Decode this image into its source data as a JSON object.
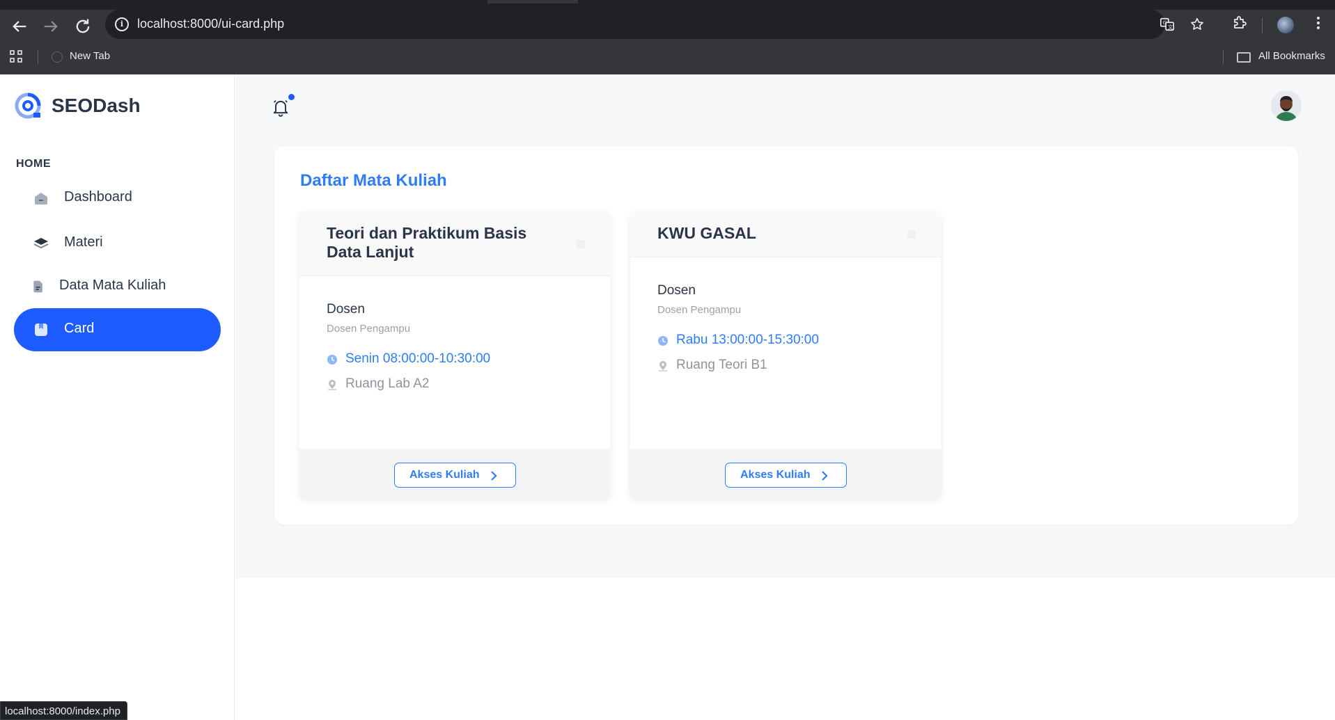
{
  "browser": {
    "url": "localhost:8000/ui-card.php",
    "bookmarks": [
      "New Tab"
    ],
    "all_bookmarks_label": "All Bookmarks",
    "status_url": "localhost:8000/index.php",
    "icons": [
      "back-icon",
      "forward-icon",
      "reload-icon",
      "site-info-icon",
      "translate-icon",
      "star-icon",
      "extensions-icon",
      "profile-avatar",
      "menu-icon",
      "apps-icon",
      "folder-icon"
    ]
  },
  "sidebar": {
    "brand": "SEODash",
    "section_caption": "HOME",
    "items": [
      {
        "label": "Dashboard",
        "icon": "dashboard-icon",
        "active": false
      },
      {
        "label": "Materi",
        "icon": "layers-icon",
        "active": false
      },
      {
        "label": "Data Mata Kuliah",
        "icon": "file-icon",
        "active": false
      },
      {
        "label": "Card",
        "icon": "bookmark-card-icon",
        "active": true
      }
    ]
  },
  "header": {
    "icons": [
      "bell-icon",
      "user-avatar"
    ]
  },
  "main": {
    "title": "Daftar Mata Kuliah",
    "courses": [
      {
        "title": "Teori dan Praktikum Basis Data Lanjut",
        "dosen_label": "Dosen",
        "dosen_value": "Dosen Pengampu",
        "schedule": "Senin 08:00:00-10:30:00",
        "room": "Ruang Lab A2",
        "button": "Akses Kuliah"
      },
      {
        "title": "KWU GASAL",
        "dosen_label": "Dosen",
        "dosen_value": "Dosen Pengampu",
        "schedule": "Rabu 13:00:00-15:30:00",
        "room": "Ruang Teori B1",
        "button": "Akses Kuliah"
      }
    ]
  },
  "colors": {
    "primary": "#1f5cff",
    "accent_text": "#2e7cf6",
    "heading": "#2a3547",
    "muted": "#8d949d",
    "page_bg": "#f6f7f9"
  }
}
